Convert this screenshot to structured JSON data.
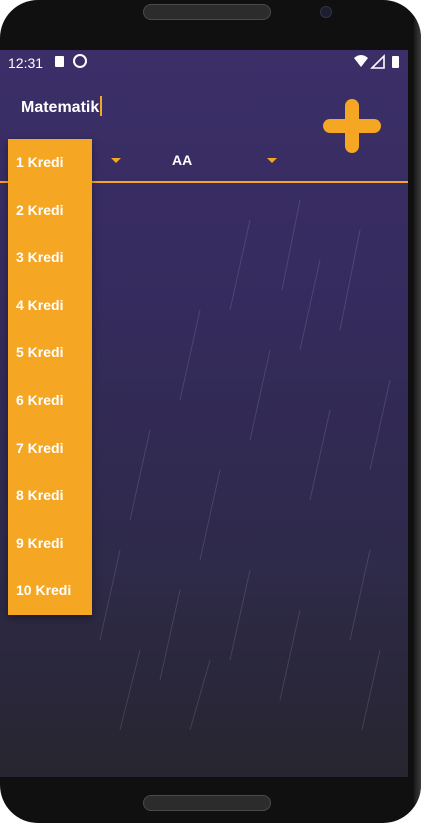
{
  "status_bar": {
    "time": "12:31"
  },
  "form": {
    "course_name_value": "Matematik"
  },
  "dropdowns": {
    "grade_selected": "AA"
  },
  "credit_menu": {
    "items": [
      "1 Kredi",
      "2 Kredi",
      "3 Kredi",
      "4 Kredi",
      "5 Kredi",
      "6 Kredi",
      "7 Kredi",
      "8 Kredi",
      "9 Kredi",
      "10 Kredi"
    ]
  },
  "icons": {
    "add": "plus-icon",
    "sim": "sim-card-icon",
    "sync": "sync-icon",
    "wifi": "wifi-icon",
    "signal": "signal-icon",
    "battery": "battery-icon",
    "back": "back-icon",
    "home": "home-icon",
    "recents": "recents-icon"
  },
  "colors": {
    "accent": "#f5a623",
    "background_top": "#3c2f69",
    "background_bottom": "#27252f",
    "text": "#ffffff"
  }
}
